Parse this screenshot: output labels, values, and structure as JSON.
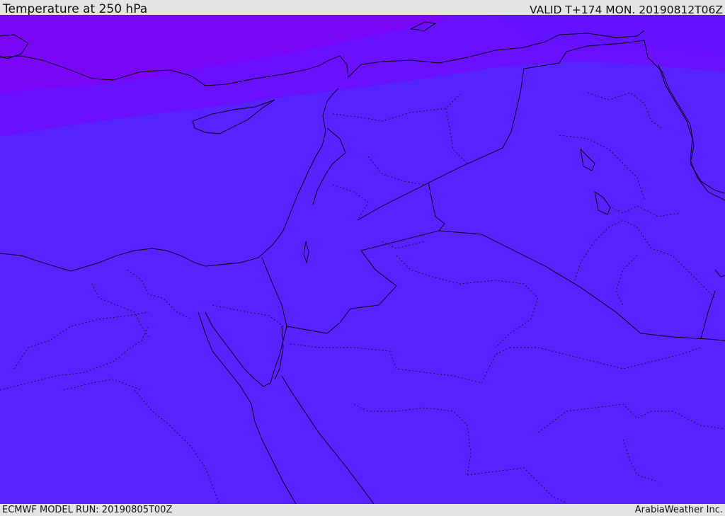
{
  "header": {
    "title": "Temperature at 250 hPa",
    "valid": "VALID T+174 MON. 20190812T06Z"
  },
  "footer": {
    "model_run": "ECMWF MODEL RUN: 20190805T00Z",
    "credit": "ArabiaWeather Inc."
  },
  "map": {
    "fill_colors": {
      "main": "#5622ff",
      "cold_band": "#6a10ff",
      "coldest_band": "#7a06f8",
      "east_band": "#5c1cff"
    },
    "coastline_color": "#000000",
    "border_style": "dotted",
    "icon": "none"
  }
}
